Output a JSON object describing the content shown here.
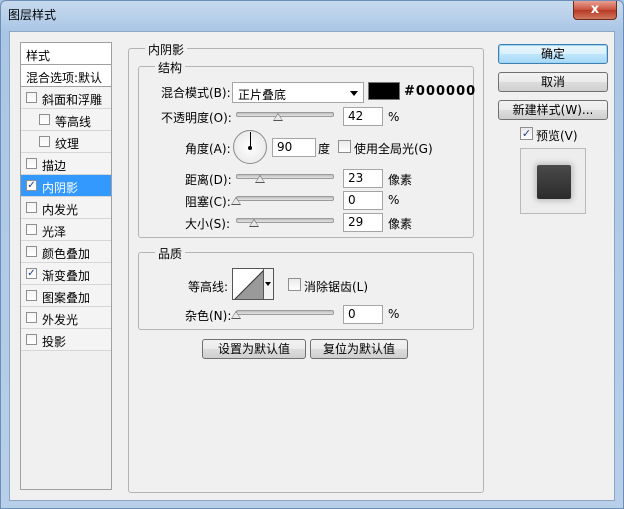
{
  "window": {
    "title": "图层样式",
    "close_label": "x"
  },
  "style_list": {
    "header": "样式",
    "blend_options": "混合选项:默认",
    "items": [
      {
        "label": "斜面和浮雕",
        "checked": false
      },
      {
        "label": "等高线",
        "checked": false
      },
      {
        "label": "纹理",
        "checked": false
      },
      {
        "label": "描边",
        "checked": false
      },
      {
        "label": "内阴影",
        "checked": true
      },
      {
        "label": "内发光",
        "checked": false
      },
      {
        "label": "光泽",
        "checked": false
      },
      {
        "label": "颜色叠加",
        "checked": false
      },
      {
        "label": "渐变叠加",
        "checked": true
      },
      {
        "label": "图案叠加",
        "checked": false
      },
      {
        "label": "外发光",
        "checked": false
      },
      {
        "label": "投影",
        "checked": false
      }
    ]
  },
  "inner_shadow": {
    "title": "内阴影",
    "structure": {
      "title": "结构",
      "blend_mode_label": "混合模式(B):",
      "blend_mode_value": "正片叠底",
      "color_hex_label": "#000000",
      "opacity_label": "不透明度(O):",
      "opacity_value": "42",
      "opacity_unit": "%",
      "angle_label": "角度(A):",
      "angle_value": "90",
      "angle_unit": "度",
      "global_light_label": "使用全局光(G)",
      "distance_label": "距离(D):",
      "distance_value": "23",
      "distance_unit": "像素",
      "choke_label": "阻塞(C):",
      "choke_value": "0",
      "choke_unit": "%",
      "size_label": "大小(S):",
      "size_value": "29",
      "size_unit": "像素"
    },
    "quality": {
      "title": "品质",
      "contour_label": "等高线:",
      "anti_alias_label": "消除锯齿(L)",
      "noise_label": "杂色(N):",
      "noise_value": "0",
      "noise_unit": "%"
    },
    "set_default_label": "设置为默认值",
    "reset_default_label": "复位为默认值"
  },
  "sidebar_buttons": {
    "ok": "确定",
    "cancel": "取消",
    "new_style": "新建样式(W)...",
    "preview_label": "预览(V)"
  },
  "colors": {
    "shadow_color": "#000000",
    "selection": "#3399ff"
  }
}
